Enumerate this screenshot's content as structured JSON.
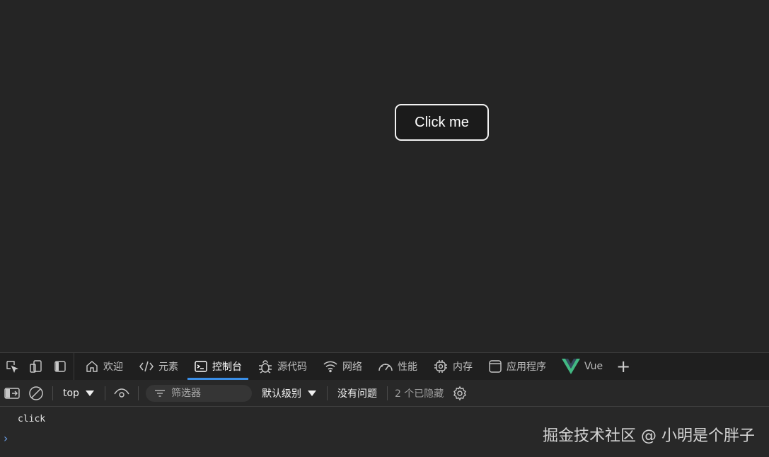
{
  "page": {
    "button_label": "Click me"
  },
  "devtools": {
    "tabs": [
      {
        "label": "欢迎",
        "icon": "home-icon"
      },
      {
        "label": "元素",
        "icon": "code-icon"
      },
      {
        "label": "控制台",
        "icon": "console-icon",
        "active": true
      },
      {
        "label": "源代码",
        "icon": "bug-icon"
      },
      {
        "label": "网络",
        "icon": "wifi-icon"
      },
      {
        "label": "性能",
        "icon": "gauge-icon"
      },
      {
        "label": "内存",
        "icon": "chip-icon"
      },
      {
        "label": "应用程序",
        "icon": "window-icon"
      },
      {
        "label": "Vue",
        "icon": "vue-logo-icon"
      }
    ],
    "toolbar": {
      "context": "top",
      "filter_placeholder": "筛选器",
      "level": "默认级别",
      "issues": "没有问题",
      "hidden": "2 个已隐藏"
    },
    "console": {
      "log": "click"
    },
    "colors": {
      "accent": "#3a8ee6",
      "vue_green": "#42b883"
    }
  },
  "watermark": "掘金技术社区 @ 小明是个胖子"
}
